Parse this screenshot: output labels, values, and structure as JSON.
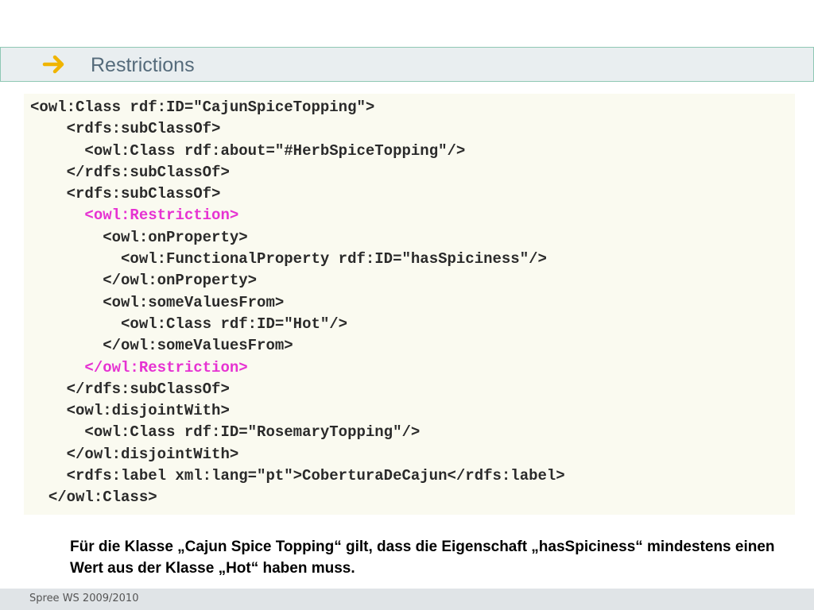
{
  "slide": {
    "title": "Restrictions",
    "title_icon": "right-arrow-icon",
    "colors": {
      "arrow": "#f0b400",
      "title_text": "#556b7b",
      "highlight": "#e632d2",
      "code_background": "#fafaf0"
    }
  },
  "code": {
    "lines": [
      {
        "indent": "",
        "text": "<owl:Class rdf:ID=\"CajunSpiceTopping\">",
        "highlight": false
      },
      {
        "indent": "    ",
        "text": "<rdfs:subClassOf>",
        "highlight": false
      },
      {
        "indent": "      ",
        "text": "<owl:Class rdf:about=\"#HerbSpiceTopping\"/>",
        "highlight": false
      },
      {
        "indent": "    ",
        "text": "</rdfs:subClassOf>",
        "highlight": false
      },
      {
        "indent": "    ",
        "text": "<rdfs:subClassOf>",
        "highlight": false
      },
      {
        "indent": "      ",
        "text": "<owl:Restriction>",
        "highlight": true
      },
      {
        "indent": "        ",
        "text": "<owl:onProperty>",
        "highlight": false
      },
      {
        "indent": "          ",
        "text": "<owl:FunctionalProperty rdf:ID=\"hasSpiciness\"/>",
        "highlight": false
      },
      {
        "indent": "        ",
        "text": "</owl:onProperty>",
        "highlight": false
      },
      {
        "indent": "        ",
        "text": "<owl:someValuesFrom>",
        "highlight": false
      },
      {
        "indent": "          ",
        "text": "<owl:Class rdf:ID=\"Hot\"/>",
        "highlight": false
      },
      {
        "indent": "        ",
        "text": "</owl:someValuesFrom>",
        "highlight": false
      },
      {
        "indent": "      ",
        "text": "</owl:Restriction>",
        "highlight": true
      },
      {
        "indent": "    ",
        "text": "</rdfs:subClassOf>",
        "highlight": false
      },
      {
        "indent": "    ",
        "text": "<owl:disjointWith>",
        "highlight": false
      },
      {
        "indent": "      ",
        "text": "<owl:Class rdf:ID=\"RosemaryTopping\"/>",
        "highlight": false
      },
      {
        "indent": "    ",
        "text": "</owl:disjointWith>",
        "highlight": false
      },
      {
        "indent": "    ",
        "text": "<rdfs:label xml:lang=\"pt\">CoberturaDeCajun</rdfs:label>",
        "highlight": false
      },
      {
        "indent": "  ",
        "text": "</owl:Class>",
        "highlight": false
      }
    ]
  },
  "note": {
    "text": "Für die Klasse „Cajun Spice Topping“ gilt, dass die Eigenschaft „hasSpiciness“ mindestens einen Wert aus der Klasse „Hot“ haben muss."
  },
  "footer": {
    "text": "Spree WS 2009/2010"
  }
}
